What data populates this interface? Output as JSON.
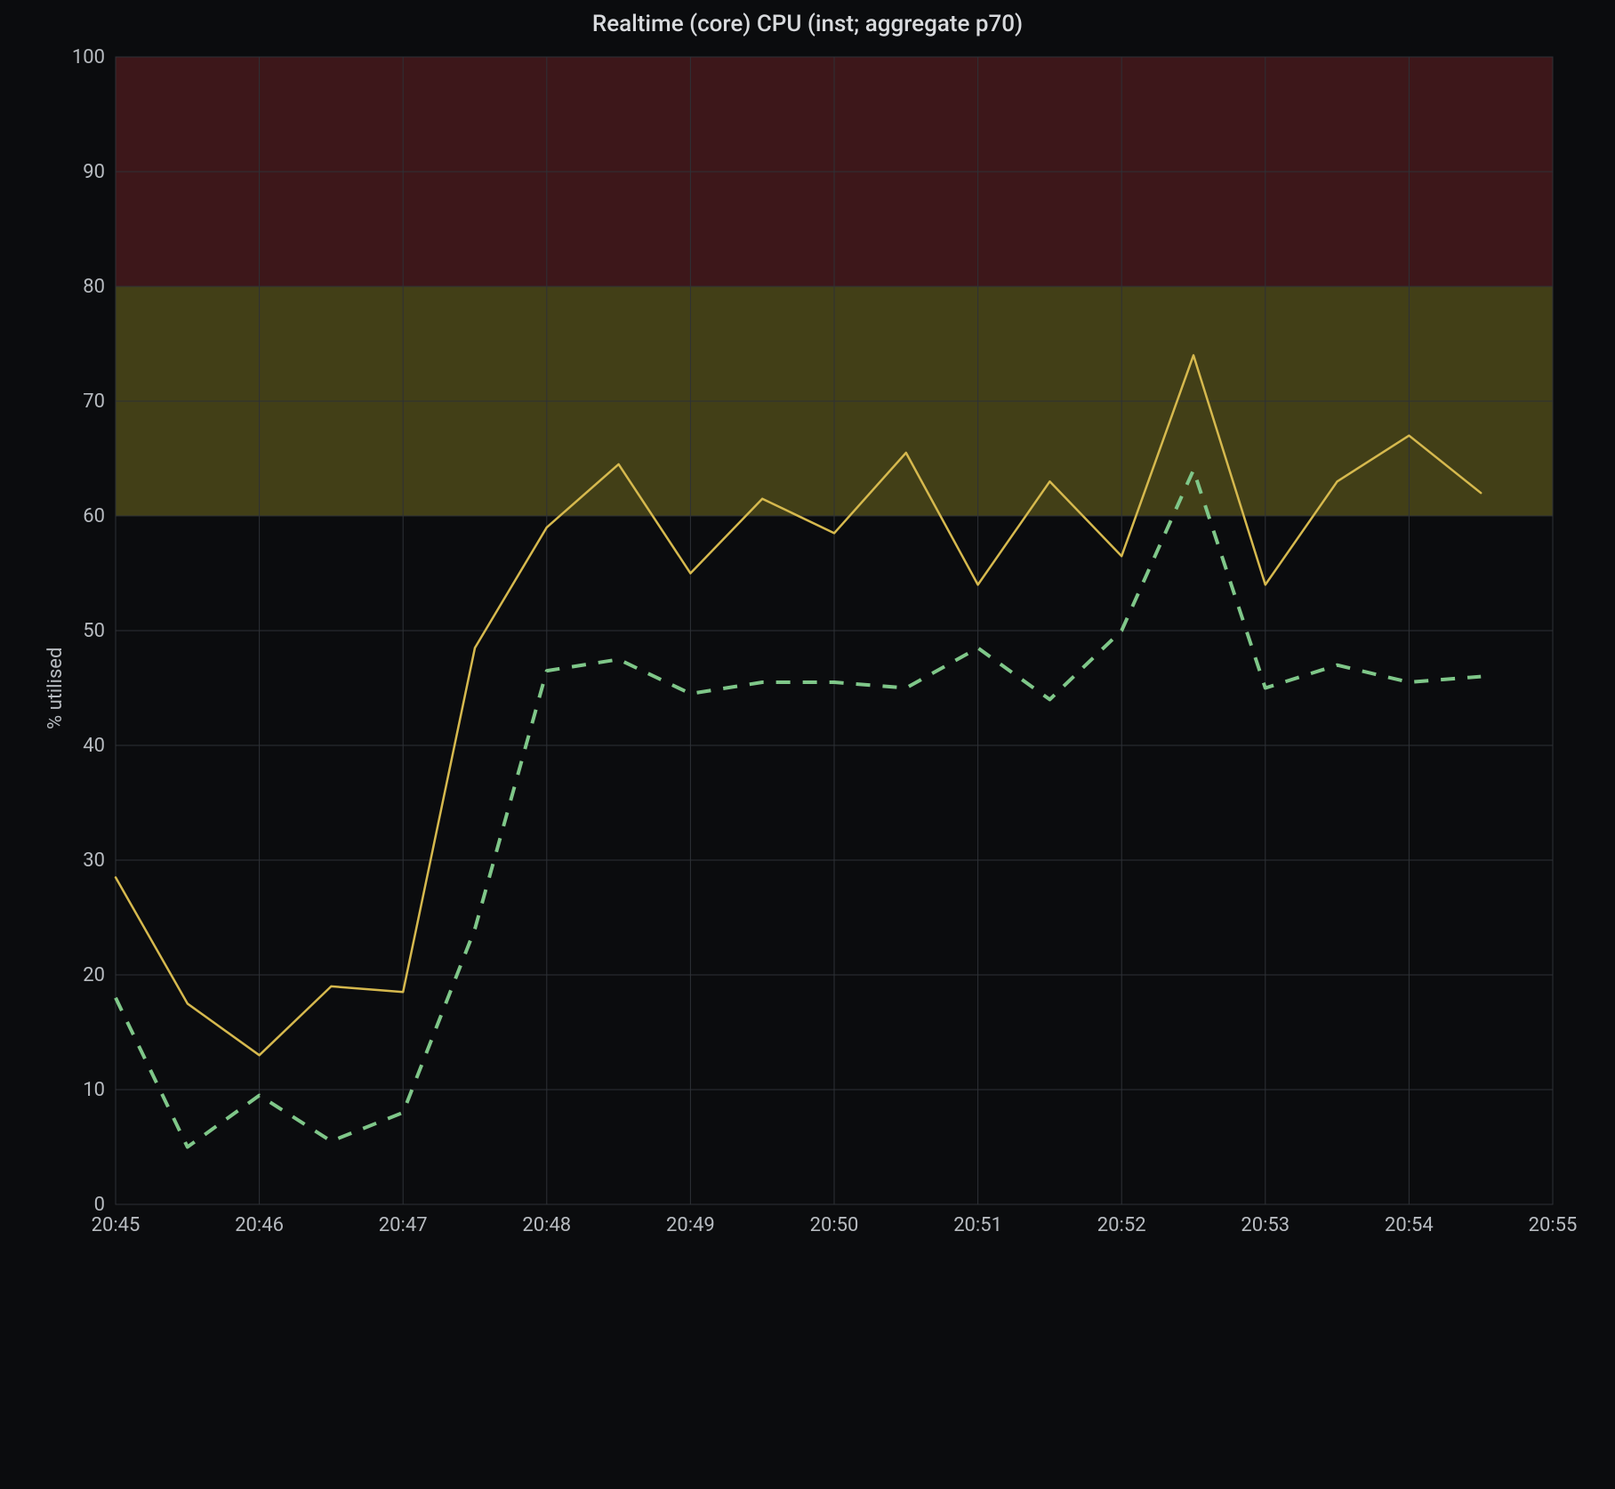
{
  "chart_data": {
    "type": "line",
    "title": "Realtime (core) CPU (inst; aggregate p70)",
    "ylabel": "% utilised",
    "xlabel": "",
    "ylim": [
      0,
      100
    ],
    "xlim": [
      0,
      10
    ],
    "y_ticks": [
      0,
      10,
      20,
      30,
      40,
      50,
      60,
      70,
      80,
      90,
      100
    ],
    "x_tick_positions": [
      0,
      1,
      2,
      3,
      4,
      5,
      6,
      7,
      8,
      9,
      10
    ],
    "x_tick_labels": [
      "20:45",
      "20:46",
      "20:47",
      "20:48",
      "20:49",
      "20:50",
      "20:51",
      "20:52",
      "20:53",
      "20:54",
      "20:55"
    ],
    "bands": [
      {
        "name": "critical",
        "from": 80,
        "to": 100,
        "class": "band-red"
      },
      {
        "name": "warning",
        "from": 60,
        "to": 80,
        "class": "band-yellow"
      }
    ],
    "series": [
      {
        "name": "series-yellow",
        "class": "line-yellow",
        "x": [
          0,
          0.5,
          1,
          1.5,
          2,
          2.5,
          3,
          3.5,
          4,
          4.5,
          5,
          5.5,
          6,
          6.5,
          7,
          7.5,
          8,
          8.5,
          9,
          9.5
        ],
        "values": [
          28.5,
          17.5,
          13,
          19,
          18.5,
          48.5,
          59,
          64.5,
          55,
          61.5,
          58.5,
          65.5,
          54,
          63,
          56.5,
          74,
          54,
          63,
          67,
          62
        ]
      },
      {
        "name": "series-green-dashed",
        "class": "line-green",
        "x": [
          0,
          0.5,
          1,
          1.5,
          2,
          2.5,
          3,
          3.5,
          4,
          4.5,
          5,
          5.5,
          6,
          6.5,
          7,
          7.5,
          8,
          8.5,
          9,
          9.5
        ],
        "values": [
          18,
          5,
          9.5,
          5.5,
          8,
          24,
          46.5,
          47.5,
          44.5,
          45.5,
          45.5,
          45,
          48.5,
          44,
          50,
          64,
          45,
          47,
          45.5,
          46
        ]
      }
    ]
  }
}
